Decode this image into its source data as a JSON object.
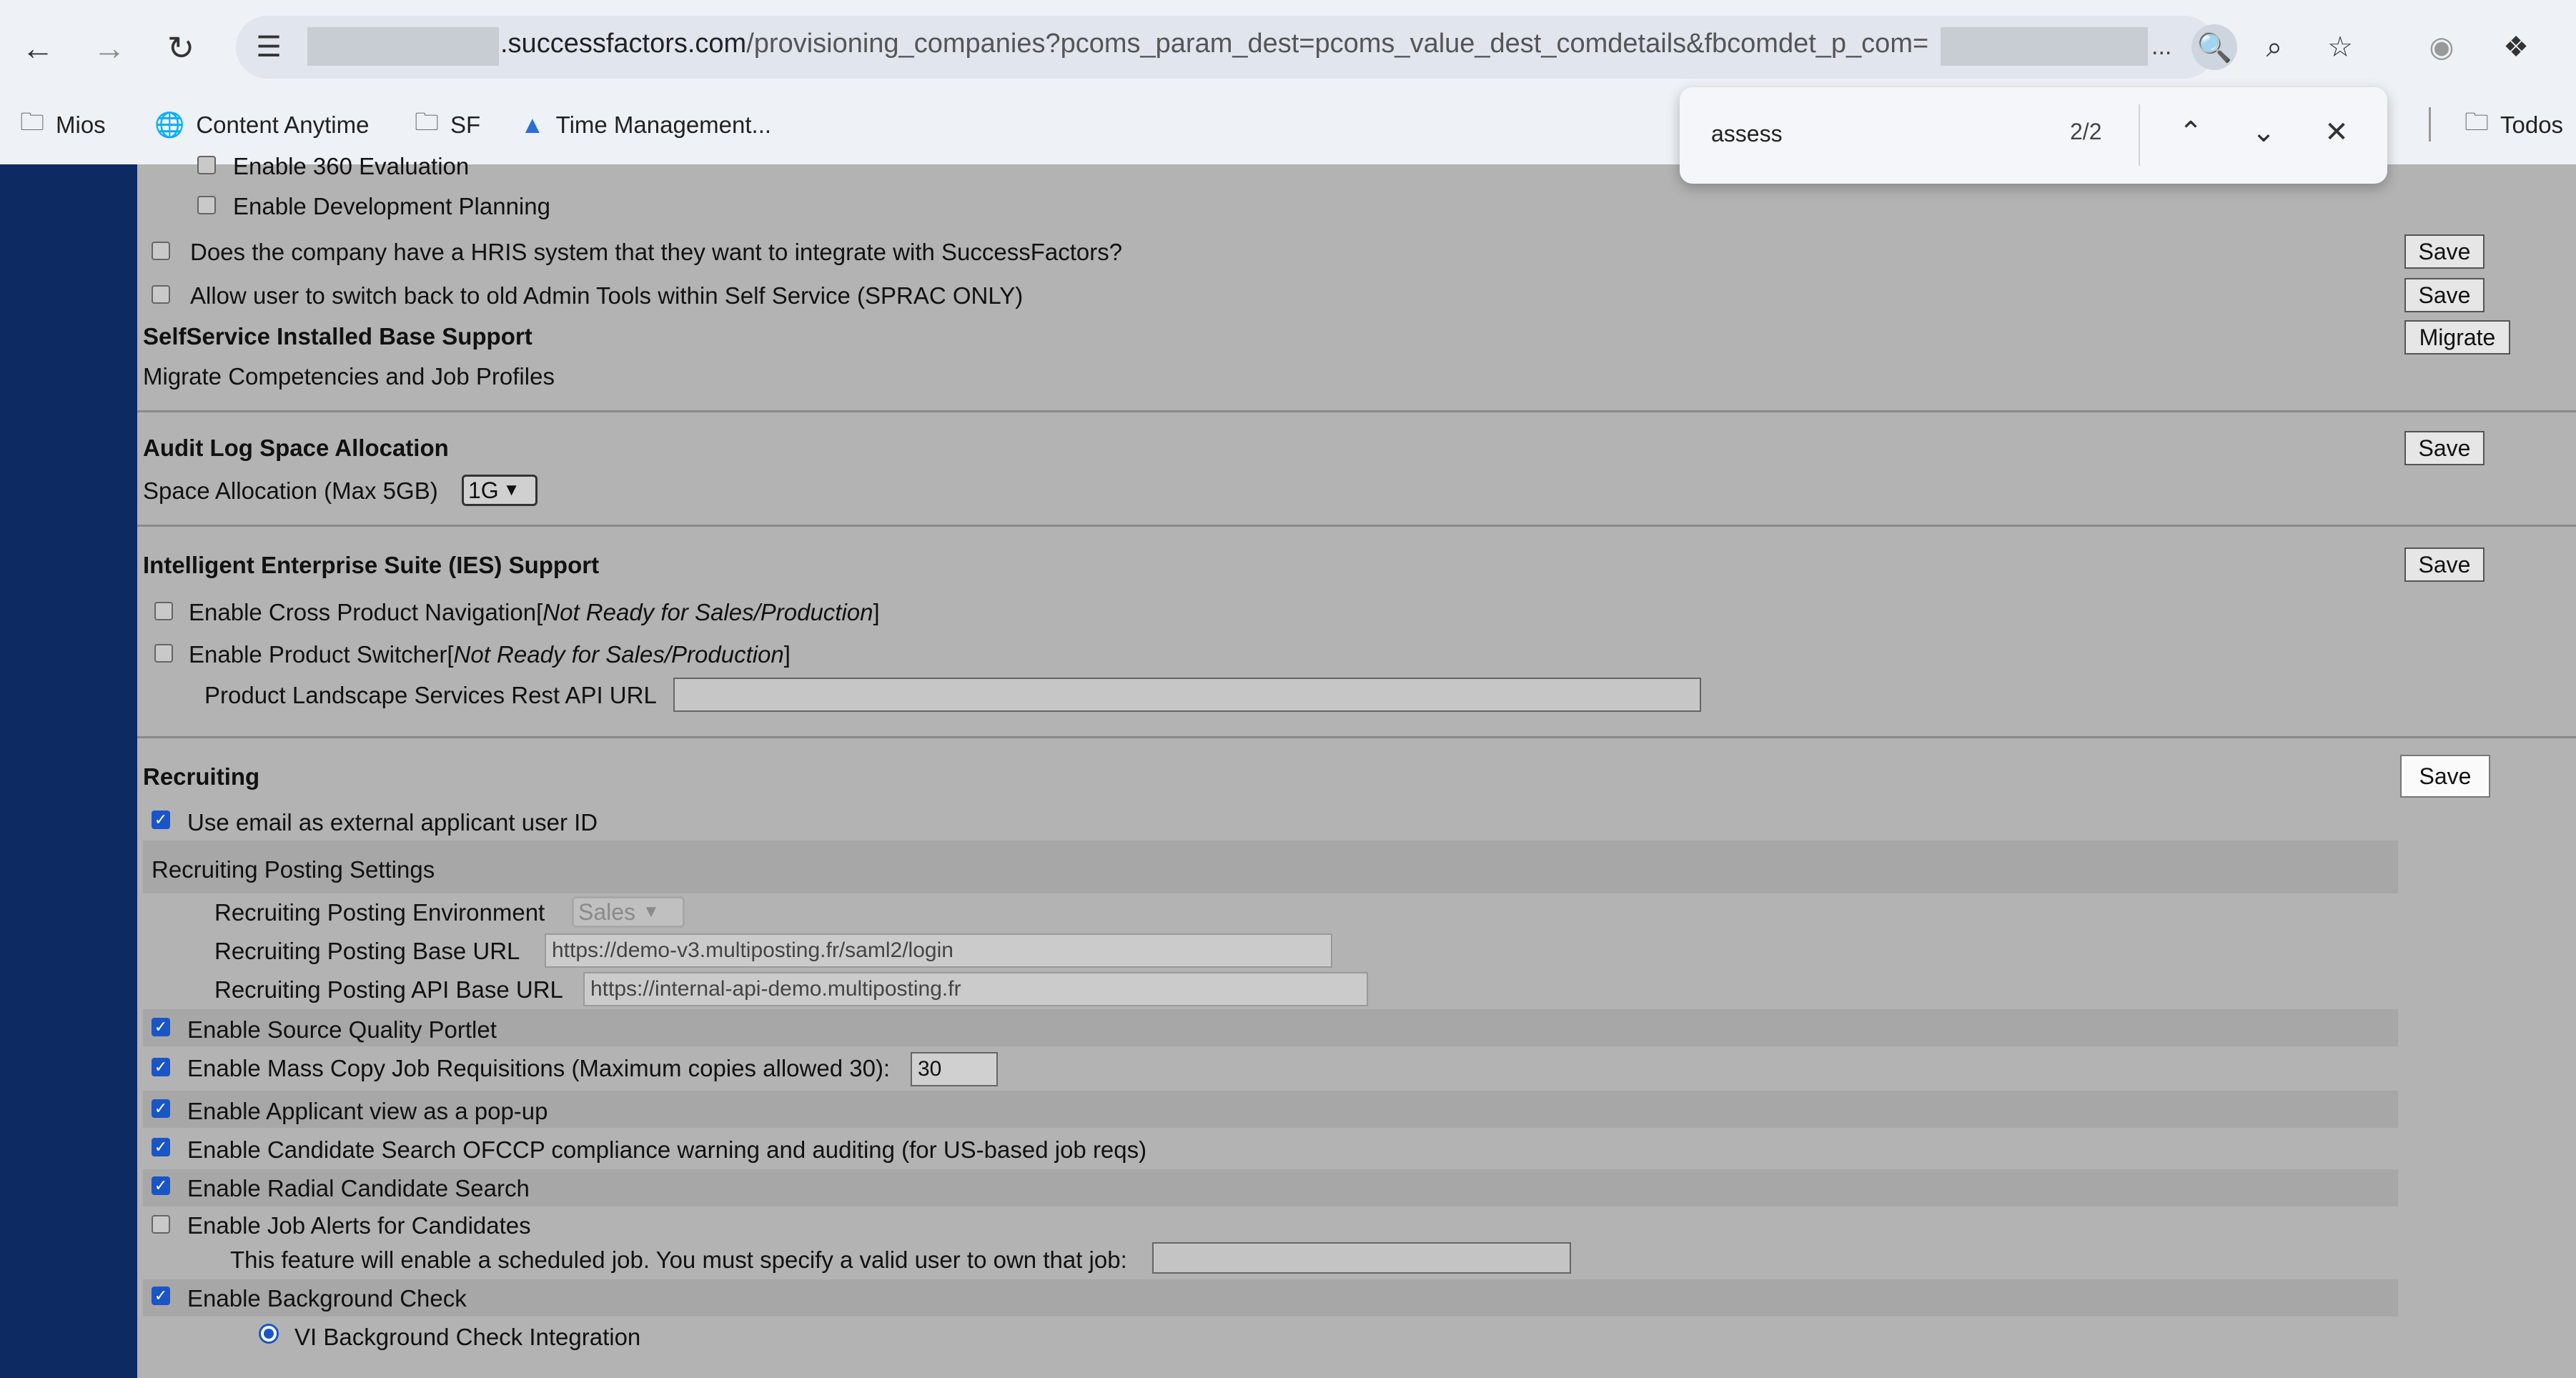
{
  "browser": {
    "url_domain": ".successfactors.com",
    "url_path": "/provisioning_companies?pcoms_param_dest=pcoms_value_dest_comdetails&fbcomdet_p_com=",
    "url_ellipsis": "...",
    "bookmarks": [
      "Mios",
      "Content Anytime",
      "SF",
      "Time Management...",
      "Todos"
    ],
    "find": {
      "query": "assess",
      "count": "2/2"
    }
  },
  "page": {
    "top_options": [
      {
        "label": "Enable 360 Evaluation",
        "checked": false
      },
      {
        "label": "Enable Development Planning",
        "checked": false
      }
    ],
    "hris": {
      "label": "Does the company have a HRIS system that they want to integrate with SuccessFactors?",
      "button": "Save"
    },
    "old_admin": {
      "label": "Allow user to switch back to old Admin Tools within Self Service (SPRAC ONLY)",
      "button": "Save"
    },
    "selfservice": {
      "title": "SelfService Installed Base Support",
      "desc": "Migrate Competencies and Job Profiles",
      "button": "Migrate"
    },
    "audit": {
      "title": "Audit Log Space Allocation",
      "label": "Space Allocation (Max 5GB)",
      "value": "1G",
      "button": "Save"
    },
    "ies": {
      "title": "Intelligent Enterprise Suite (IES) Support",
      "button": "Save",
      "cross_nav": "Enable Cross Product Navigation",
      "switcher": "Enable Product Switcher",
      "not_ready": "Not Ready for Sales/Production",
      "api_label": "Product Landscape Services Rest API URL",
      "api_value": ""
    },
    "recruiting": {
      "title": "Recruiting",
      "button": "Save",
      "email_id": "Use email as external applicant user ID",
      "posting_title": "Recruiting Posting Settings",
      "env_label": "Recruiting Posting Environment",
      "env_value": "Sales",
      "base_url_label": "Recruiting Posting Base URL",
      "base_url_value": "https://demo-v3.multiposting.fr/saml2/login",
      "api_url_label": "Recruiting Posting API Base URL",
      "api_url_value": "https://internal-api-demo.multiposting.fr",
      "source_quality": "Enable Source Quality Portlet",
      "mass_copy": "Enable Mass Copy Job Requisitions (Maximum copies allowed 30):",
      "mass_copy_value": "30",
      "applicant_popup": "Enable Applicant view as a pop-up",
      "ofccp": "Enable Candidate Search OFCCP compliance warning and auditing (for US-based job reqs)",
      "radial": "Enable Radial Candidate Search",
      "job_alerts": "Enable Job Alerts for Candidates",
      "job_alerts_note": "This feature will enable a scheduled job. You must specify a valid user to own that job:",
      "background": "Enable Background Check",
      "vi_background": "VI Background Check Integration"
    }
  },
  "colors": {
    "left_band": "#0d2a63",
    "checkbox": "#1a55c7"
  }
}
